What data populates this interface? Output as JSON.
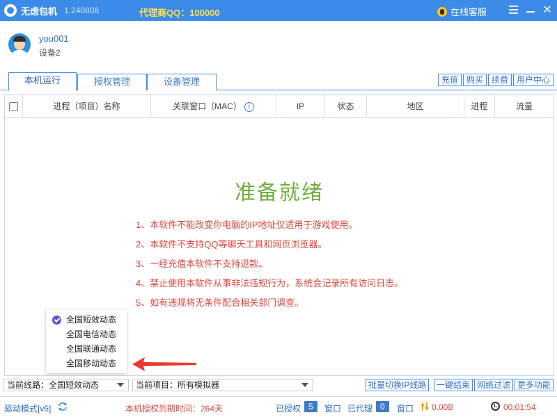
{
  "titlebar": {
    "app_name": "无虑包机",
    "version": "1.240806",
    "agent_qq": "代理商QQ：100000",
    "online_service": "在线客服"
  },
  "user": {
    "username": "you001",
    "device": "设备2"
  },
  "tabs": [
    {
      "label": "本机运行",
      "active": true
    },
    {
      "label": "授权管理",
      "active": false
    },
    {
      "label": "设备管理",
      "active": false
    }
  ],
  "top_actions": [
    "充值",
    "购买",
    "续费",
    "用户中心"
  ],
  "table": {
    "columns": [
      "进程（项目）名称",
      "关联窗口（MAC）",
      "IP",
      "状态",
      "地区",
      "进程",
      "流量"
    ]
  },
  "ready": {
    "title": "准备就绪",
    "notices": [
      "1、本软件不能改变你电脑的IP地址仅适用于游戏使用。",
      "2、本软件不支持QQ等聊天工具和网页浏览器。",
      "3、一经充值本软件不支持退款。",
      "4、禁止使用本软件从事非法违规行为，系统会记录所有访问日志。",
      "5、如有违规将无条件配合相关部门调查。"
    ]
  },
  "line_options": [
    {
      "label": "全国短效动态",
      "selected": true
    },
    {
      "label": "全国电信动态",
      "selected": false
    },
    {
      "label": "全国联通动态",
      "selected": false
    },
    {
      "label": "全国移动动态",
      "selected": false
    }
  ],
  "controls": {
    "current_line": "当前线路：全国短效动态",
    "current_project": "当前项目：所有模拟器",
    "batch_switch": "批量切换IP线路",
    "end_all": "一键结束",
    "net_filter": "网络过滤",
    "more": "更多功能"
  },
  "status": {
    "mode": "驱动模式[v5]",
    "expire": "本机授权到期时间：264天",
    "authorized_label": "已授权",
    "authorized_count": "5",
    "window1": "窗口",
    "agent_label": "已代理",
    "agent_count": "0",
    "window2": "窗口",
    "traffic": "0.00B",
    "elapsed": "00:01:54"
  },
  "colors": {
    "accent": "#3d8be8",
    "ready": "#6fae3a",
    "warning": "#d9473d",
    "qq": "#ffe14d"
  }
}
